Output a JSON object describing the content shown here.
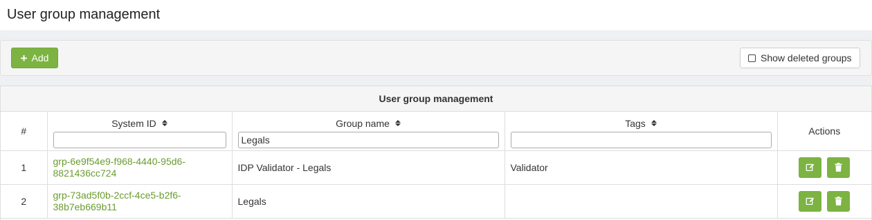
{
  "header": {
    "title": "User group management"
  },
  "toolbar": {
    "add_label": "Add",
    "show_deleted_label": "Show deleted groups",
    "show_deleted_checked": false
  },
  "panel": {
    "title": "User group management"
  },
  "table": {
    "columns": {
      "num": "#",
      "system_id": "System ID",
      "group_name": "Group name",
      "tags": "Tags",
      "actions": "Actions"
    },
    "filters": {
      "system_id": "",
      "group_name": "Legals",
      "tags": ""
    },
    "rows": [
      {
        "num": "1",
        "system_id_line1": "grp-6e9f54e9-f968-4440-95d6-",
        "system_id_line2": "8821436cc724",
        "group_name": "IDP Validator - Legals",
        "tags": "Validator"
      },
      {
        "num": "2",
        "system_id_line1": "grp-73ad5f0b-2ccf-4ce5-b2f6-",
        "system_id_line2": "38b7eb669b11",
        "group_name": "Legals",
        "tags": ""
      }
    ]
  },
  "colors": {
    "accent": "#7cb342",
    "link": "#6a9c2f"
  },
  "icons": {
    "add": "plus-icon",
    "edit": "edit-icon",
    "delete": "trash-icon",
    "sort": "sort-icon"
  }
}
